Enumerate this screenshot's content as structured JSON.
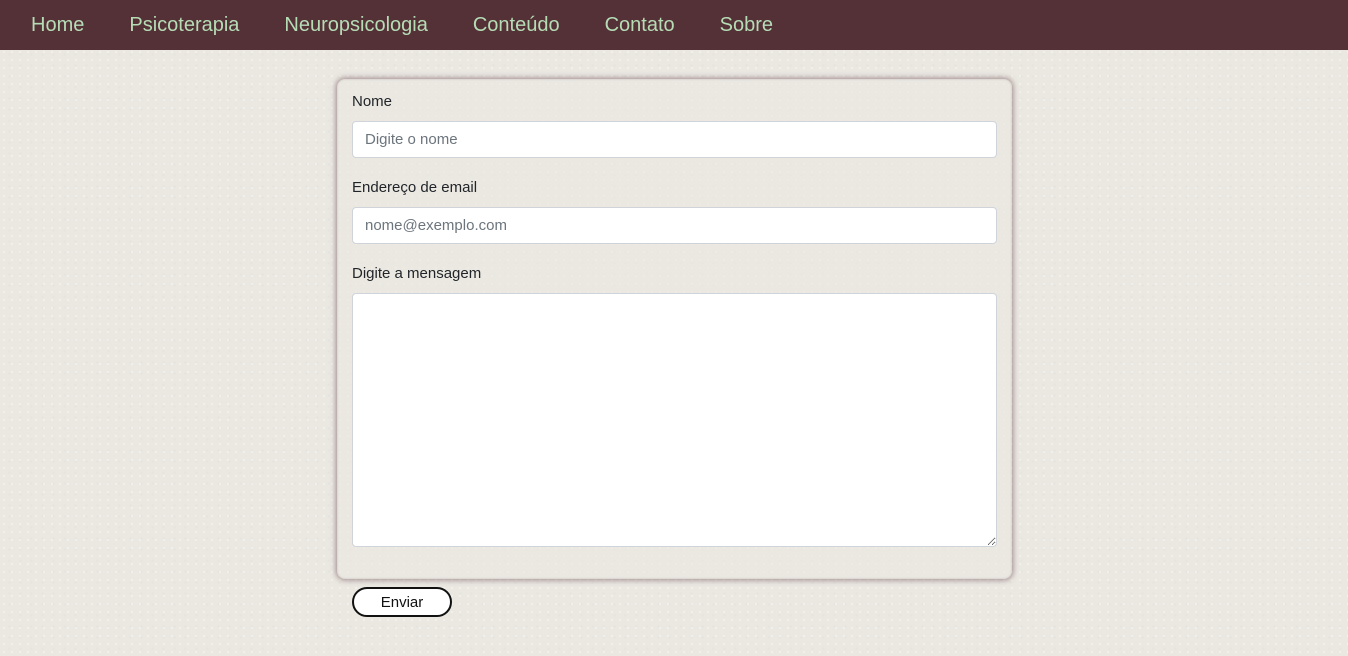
{
  "nav": {
    "items": [
      {
        "label": "Home"
      },
      {
        "label": "Psicoterapia"
      },
      {
        "label": "Neuropsicologia"
      },
      {
        "label": "Conteúdo"
      },
      {
        "label": "Contato"
      },
      {
        "label": "Sobre"
      }
    ]
  },
  "form": {
    "name": {
      "label": "Nome",
      "placeholder": "Digite o nome",
      "value": ""
    },
    "email": {
      "label": "Endereço de email",
      "placeholder": "nome@exemplo.com",
      "value": ""
    },
    "message": {
      "label": "Digite a mensagem",
      "value": ""
    },
    "submit_label": "Enviar"
  },
  "colors": {
    "navbar_bg": "#533136",
    "nav_link": "#b6dcb6",
    "page_bg": "#ebe8e2"
  }
}
